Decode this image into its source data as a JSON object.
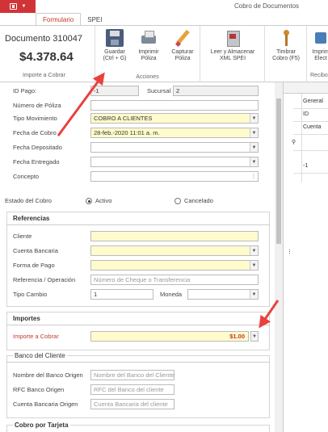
{
  "window": {
    "title": "Cobro de Documentos"
  },
  "tabs": [
    {
      "label": "Formulario",
      "active": true
    },
    {
      "label": "SPEI",
      "active": false
    }
  ],
  "document": {
    "title": "Documento 310047",
    "amount": "$4.378.64",
    "caption": "Importe a Cobrar"
  },
  "ribbon": {
    "actions_caption": "Acciones",
    "right_caption": "Recibo",
    "buttons": {
      "save": {
        "line1": "Guardar",
        "line2": "(Ctrl + G)",
        "icon": "save-icon"
      },
      "print": {
        "line1": "Imprimir",
        "line2": "Póliza",
        "icon": "printer-icon"
      },
      "capture": {
        "line1": "Capturar",
        "line2": "Póliza",
        "icon": "pencil-icon"
      },
      "xml": {
        "line1": "Leer y Almacenar",
        "line2": "XML SPEI",
        "icon": "xml-file-icon"
      },
      "stamp": {
        "line1": "Timbrar",
        "line2": "Cobro (F5)",
        "icon": "stamp-icon"
      },
      "elec": {
        "line1": "Imprim",
        "line2": "Elect",
        "icon": "electronic-print-icon"
      }
    }
  },
  "form": {
    "id_pago": {
      "label": "ID Pago:",
      "value": "-1"
    },
    "sucursal": {
      "label": "Sucursal",
      "value": "2"
    },
    "numero_poliza": {
      "label": "Número de Póliza",
      "value": ""
    },
    "tipo_movimiento": {
      "label": "Tipo Movimiento",
      "value": "COBRO A CLIENTES"
    },
    "fecha_cobro": {
      "label": "Fecha de Cobro",
      "value": "28-feb.-2020 11:01 a. m."
    },
    "fecha_depositado": {
      "label": "Fecha Depositado",
      "value": ""
    },
    "fecha_entregado": {
      "label": "Fecha Entregado",
      "value": ""
    },
    "concepto": {
      "label": "Concepto",
      "value": ""
    },
    "estado_cobro": {
      "label": "Estado del Cobro",
      "options": [
        {
          "label": "Activo",
          "selected": true
        },
        {
          "label": "Cancelado",
          "selected": false
        }
      ]
    },
    "referencias": {
      "title": "Referencias",
      "cliente": {
        "label": "Cliente",
        "value": ""
      },
      "cuenta_bancaria": {
        "label": "Cuenta Bancaria",
        "value": ""
      },
      "forma_pago": {
        "label": "Forma de Pago",
        "value": ""
      },
      "referencia_operacion": {
        "label": "Referencia / Operación",
        "placeholder": "Número de Cheque o Transferencia"
      },
      "tipo_cambio": {
        "label": "Tipo Cambio",
        "value": "1"
      },
      "moneda": {
        "label": "Moneda",
        "value": ""
      }
    },
    "importes": {
      "title": "Importes",
      "importe_cobrar": {
        "label": "Importe a Cobrar",
        "value": "$1.00"
      }
    },
    "banco_cliente": {
      "title": "Banco del Cliente",
      "nombre_banco": {
        "label": "Nombre del Banco Origen",
        "placeholder": "Nombre del Banco del Cliente"
      },
      "rfc_banco": {
        "label": "RFC Banco Origen",
        "placeholder": "RFC del Banco del cliente"
      },
      "cuenta_origen": {
        "label": "Cuenta Bancaria Origen",
        "placeholder": "Cuenta Bancaria del cliente"
      }
    },
    "tarjeta": {
      "title": "Cobro por Tarjeta"
    }
  },
  "right_panel": {
    "cells": [
      "General",
      "ID",
      "Cuenta",
      "-1"
    ]
  },
  "colors": {
    "accent_red": "#d13438",
    "arrow_red": "#e8423f",
    "field_yellow": "#fffbcc",
    "amount_red": "#c0392b"
  }
}
